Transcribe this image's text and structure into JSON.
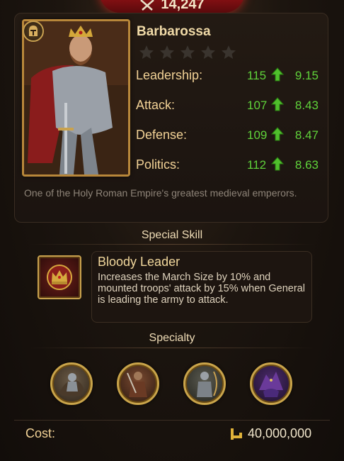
{
  "power": {
    "value": "14,247",
    "icon": "crossed-swords-icon"
  },
  "general": {
    "name": "Barbarossa",
    "stars_filled": 0,
    "stars_total": 5,
    "bio": "One of the Holy Roman Empire's greatest medieval emperors."
  },
  "stats": [
    {
      "label": "Leadership:",
      "base": "115",
      "growth": "9.15"
    },
    {
      "label": "Attack:",
      "base": "107",
      "growth": "8.43"
    },
    {
      "label": "Defense:",
      "base": "109",
      "growth": "8.47"
    },
    {
      "label": "Politics:",
      "base": "112",
      "growth": "8.63"
    }
  ],
  "special_skill": {
    "section_title": "Special Skill",
    "name": "Bloody Leader",
    "description": "Increases the March Size by 10% and mounted troops' attack by 15% when General is leading the army to attack."
  },
  "specialty": {
    "section_title": "Specialty",
    "medals": [
      "cavalry-medal-icon",
      "infantry-medal-icon",
      "archer-medal-icon",
      "dragon-medal-icon"
    ]
  },
  "cost": {
    "label": "Cost:",
    "value": "40,000,000",
    "icon": "gold-key-icon"
  },
  "colors": {
    "stat_green": "#5fd23a",
    "gold_label": "#f2d296",
    "frame_gold": "#b8873a"
  }
}
